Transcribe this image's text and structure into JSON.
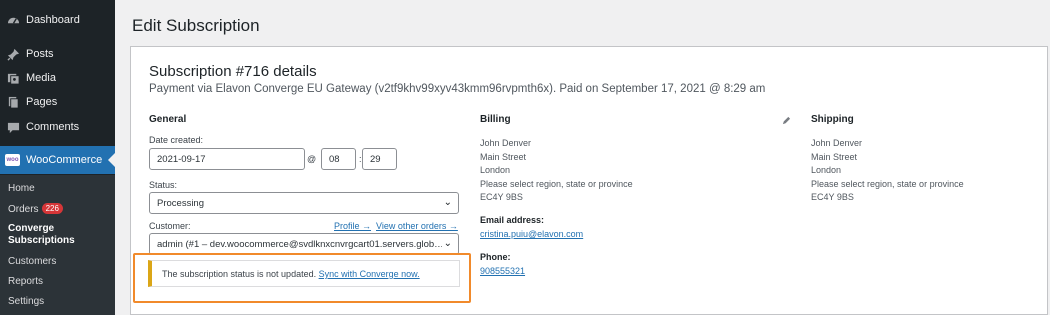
{
  "sidebar": {
    "items": [
      {
        "label": "Dashboard",
        "icon": "dashboard-icon"
      },
      {
        "label": "Posts",
        "icon": "pin-icon"
      },
      {
        "label": "Media",
        "icon": "media-icon"
      },
      {
        "label": "Pages",
        "icon": "pages-icon"
      },
      {
        "label": "Comments",
        "icon": "comments-icon"
      },
      {
        "label": "WooCommerce",
        "icon": "woocommerce-icon",
        "badge": "woo"
      }
    ],
    "submenu": {
      "home": "Home",
      "orders": "Orders",
      "orders_count": "226",
      "converge_subscriptions": "Converge Subscriptions",
      "customers": "Customers",
      "reports": "Reports",
      "settings": "Settings"
    }
  },
  "page": {
    "title": "Edit Subscription",
    "subscription_title": "Subscription #716 details",
    "meta": "Payment via Elavon Converge EU Gateway (v2tf9khv99xyv43kmm96rvpmth6x). Paid on September 17, 2021 @ 8:29 am"
  },
  "general": {
    "heading": "General",
    "date_label": "Date created:",
    "date_value": "2021-09-17",
    "at_symbol": "@",
    "hour": "08",
    "colon": ":",
    "minute": "29",
    "status_label": "Status:",
    "status_value": "Processing",
    "customer_label": "Customer:",
    "profile_link": "Profile →",
    "other_orders_link": "View other orders →",
    "customer_value": "admin (#1 – dev.woocommerce@svdlknxcnvrgcart01.servers.glob…"
  },
  "billing": {
    "heading": "Billing",
    "address": [
      "John Denver",
      "Main Street",
      "London",
      "Please select region, state or province",
      "EC4Y 9BS"
    ],
    "email_label": "Email address:",
    "email": "cristina.puiu@elavon.com",
    "phone_label": "Phone:",
    "phone": "908555321"
  },
  "shipping": {
    "heading": "Shipping",
    "address": [
      "John Denver",
      "Main Street",
      "London",
      "Please select region, state or province",
      "EC4Y 9BS"
    ]
  },
  "notice": {
    "text": "The subscription status is not updated.",
    "link": "Sync with Converge now."
  },
  "colors": {
    "sidebar_bg": "#1d2327",
    "active_bg": "#2271b1",
    "link": "#2271b1",
    "notice_border": "#dba617",
    "highlight": "#f18a2b",
    "count_badge": "#d63638"
  }
}
